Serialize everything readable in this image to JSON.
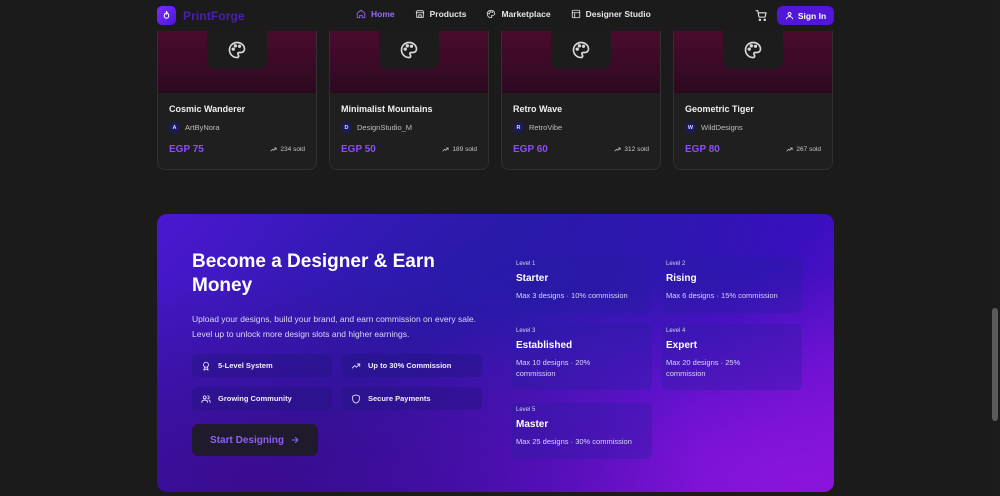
{
  "brand": {
    "name": "PrintForge",
    "accent": "#5216d8"
  },
  "nav": {
    "links": [
      {
        "label": "Home",
        "icon": "home-icon",
        "active": true
      },
      {
        "label": "Products",
        "icon": "store-icon",
        "active": false
      },
      {
        "label": "Marketplace",
        "icon": "palette-icon",
        "active": false
      },
      {
        "label": "Designer Studio",
        "icon": "grid-icon",
        "active": false
      }
    ],
    "signin_label": "Sign In"
  },
  "products": [
    {
      "title": "Cosmic Wanderer",
      "author_initial": "A",
      "author": "ArtByNora",
      "price": "EGP 75",
      "sold": "234 sold"
    },
    {
      "title": "Minimalist Mountains",
      "author_initial": "D",
      "author": "DesignStudio_M",
      "price": "EGP 50",
      "sold": "189 sold"
    },
    {
      "title": "Retro Wave",
      "author_initial": "R",
      "author": "RetroVibe",
      "price": "EGP 60",
      "sold": "312 sold"
    },
    {
      "title": "Geometric Tiger",
      "author_initial": "W",
      "author": "WildDesigns",
      "price": "EGP 80",
      "sold": "267 sold"
    }
  ],
  "promo": {
    "title": "Become a Designer & Earn Money",
    "description": "Upload your designs, build your brand, and earn commission on every sale. Level up to unlock more design slots and higher earnings.",
    "features": [
      {
        "label": "5-Level System",
        "icon": "award-icon"
      },
      {
        "label": "Up to 30% Commission",
        "icon": "trending-up-icon"
      },
      {
        "label": "Growing Community",
        "icon": "users-icon"
      },
      {
        "label": "Secure Payments",
        "icon": "shield-icon"
      }
    ],
    "cta_label": "Start Designing",
    "levels": [
      {
        "num": "Level 1",
        "name": "Starter",
        "detail": "Max 3 designs · 10% commission"
      },
      {
        "num": "Level 2",
        "name": "Rising",
        "detail": "Max 6 designs · 15% commission"
      },
      {
        "num": "Level 3",
        "name": "Established",
        "detail": "Max 10 designs · 20% commission"
      },
      {
        "num": "Level 4",
        "name": "Expert",
        "detail": "Max 20 designs · 25% commission"
      },
      {
        "num": "Level 5",
        "name": "Master",
        "detail": "Max 25 designs · 30% commission"
      }
    ]
  }
}
